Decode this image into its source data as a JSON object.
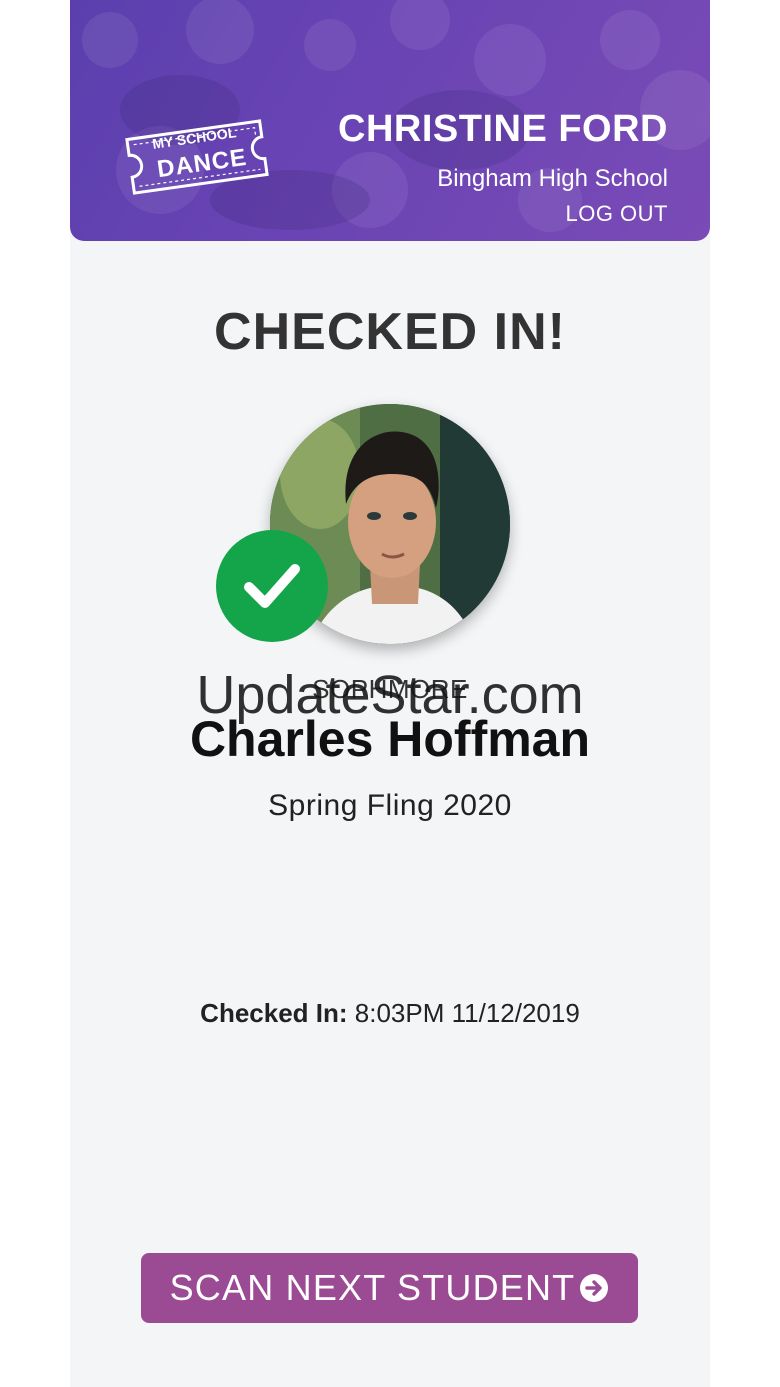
{
  "header": {
    "logo_line1": "MY SCHOOL",
    "logo_line2": "DANCE",
    "user_name": "CHRISTINE FORD",
    "school": "Bingham High School",
    "logout_label": "LOG OUT"
  },
  "status": {
    "title": "CHECKED IN!"
  },
  "student": {
    "grade": "SOPHMORE",
    "name": "Charles Hoffman",
    "event": "Spring Fling 2020",
    "checkin_label": "Checked In:",
    "checkin_time": "8:03PM 11/12/2019"
  },
  "watermark": "UpdateStar.com",
  "actions": {
    "scan_next_label": "SCAN NEXT STUDENT",
    "scan_next_icon": "arrow-circle-right-icon"
  },
  "icons": {
    "check": "check-icon",
    "avatar": "student-photo"
  },
  "colors": {
    "header_purple": "#6a44b4",
    "check_green": "#14a54b",
    "button_magenta": "#9b4b93",
    "background": "#f3f5f7"
  }
}
